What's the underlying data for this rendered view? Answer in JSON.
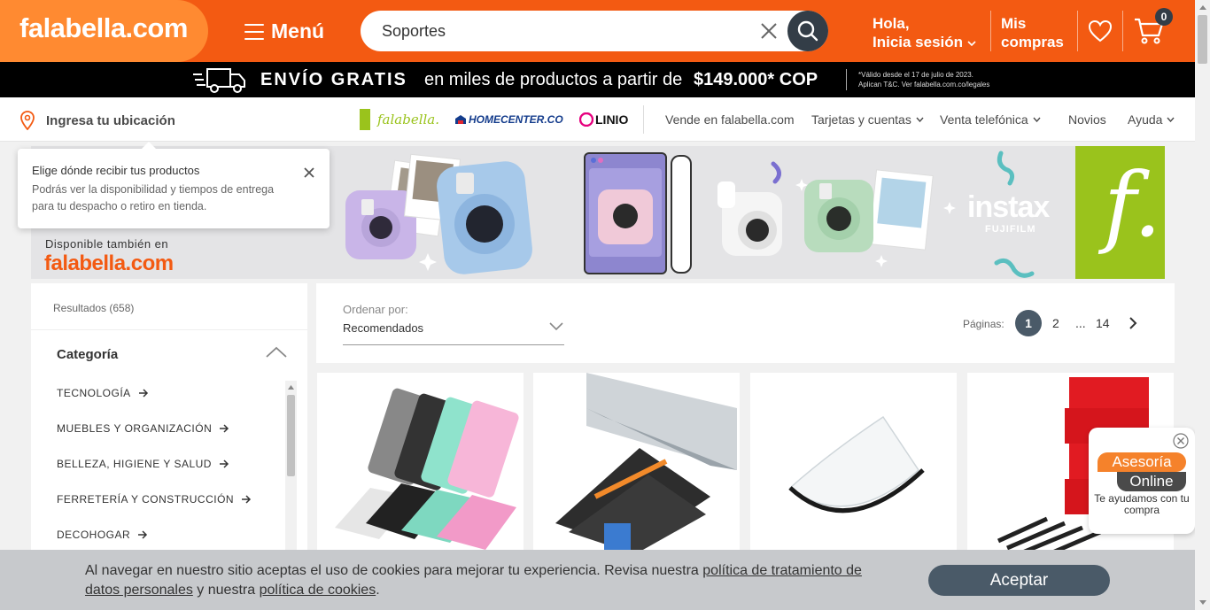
{
  "header": {
    "logo": "falabella.com",
    "menu_label": "Menú",
    "search_value": "Soportes",
    "login_line1": "Hola,",
    "login_line2": "Inicia sesión",
    "orders_line1": "Mis",
    "orders_line2": "compras",
    "cart_count": "0",
    "brand_color": "#f35a12"
  },
  "promo": {
    "title": "ENVÍO GRATIS",
    "middle": "en miles de productos a partir de",
    "price": "$149.000* COP",
    "legal_line1": "*Válido desde el 17 de julio de 2023.",
    "legal_line2": "Aplican T&C. Ver falabella.com.co/legales"
  },
  "subnav": {
    "location": "Ingresa tu ubicación",
    "brands": [
      "falabella.",
      "HOMECENTER.CO",
      "LINIO"
    ],
    "links": [
      "Vende en falabella.com",
      "Tarjetas y cuentas",
      "Venta telefónica",
      "Novios",
      "Ayuda"
    ]
  },
  "tooltip": {
    "title": "Elige dónde recibir tus productos",
    "body": "Podrás ver la disponibilidad y tiempos de entrega para tu despacho o retiro en tienda."
  },
  "banner": {
    "available": "Disponible también en",
    "logo": "falabella.com",
    "brand": "instax",
    "sub_brand": "FUJIFILM",
    "badge": "f."
  },
  "filters": {
    "results": "Resultados (658)",
    "category_title": "Categoría",
    "categories": [
      "TECNOLOGÍA",
      "MUEBLES Y ORGANIZACIÓN",
      "BELLEZA, HIGIENE Y SALUD",
      "FERRETERÍA Y CONSTRUCCIÓN",
      "DECOHOGAR"
    ]
  },
  "sort": {
    "label": "Ordenar por:",
    "value": "Recomendados",
    "pages_label": "Páginas:",
    "current_page": "1",
    "page_2": "2",
    "ellipsis": "...",
    "last_page": "14"
  },
  "chat": {
    "line1": "Asesoría",
    "line2": "Online",
    "sub": "Te ayudamos con tu compra"
  },
  "cookie": {
    "text1": "Al navegar en nuestro sitio aceptas el uso de cookies para mejorar tu experiencia. Revisa nuestra ",
    "link1": "política de tratamiento de datos personales",
    "text2": " y nuestra ",
    "link2": "política de cookies",
    "text3": ".",
    "button": "Aceptar"
  }
}
